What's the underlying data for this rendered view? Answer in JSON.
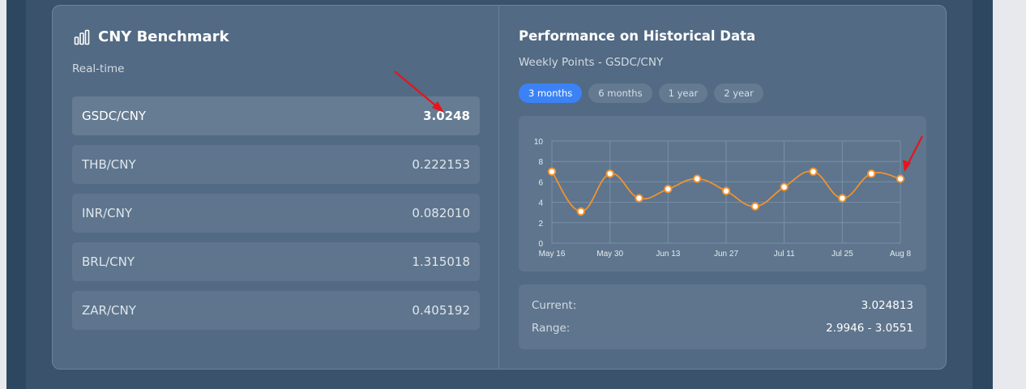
{
  "left_panel": {
    "title": "CNY Benchmark",
    "icon": "bar-chart-icon",
    "subtitle": "Real-time",
    "rates": [
      {
        "pair": "GSDC/CNY",
        "value": "3.0248",
        "active": true
      },
      {
        "pair": "THB/CNY",
        "value": "0.222153",
        "active": false
      },
      {
        "pair": "INR/CNY",
        "value": "0.082010",
        "active": false
      },
      {
        "pair": "BRL/CNY",
        "value": "1.315018",
        "active": false
      },
      {
        "pair": "ZAR/CNY",
        "value": "0.405192",
        "active": false
      }
    ]
  },
  "right_panel": {
    "title": "Performance on Historical Data",
    "subtitle": "Weekly Points - GSDC/CNY",
    "tabs": [
      {
        "label": "3 months",
        "active": true
      },
      {
        "label": "6 months",
        "active": false
      },
      {
        "label": "1 year",
        "active": false
      },
      {
        "label": "2 year",
        "active": false
      }
    ],
    "stats": {
      "current_label": "Current:",
      "current_value": "3.024813",
      "range_label": "Range:",
      "range_value": "2.9946 - 3.0551"
    }
  },
  "chart_data": {
    "type": "line",
    "x": [
      "May 16",
      "May 23",
      "May 30",
      "Jun 6",
      "Jun 13",
      "Jun 20",
      "Jun 27",
      "Jul 4",
      "Jul 11",
      "Jul 18",
      "Jul 25",
      "Aug 1",
      "Aug 8"
    ],
    "xticks": [
      "May 16",
      "May 30",
      "Jun 13",
      "Jun 27",
      "Jul 11",
      "Jul 25",
      "Aug 8"
    ],
    "values": [
      7.0,
      3.1,
      6.8,
      4.4,
      5.3,
      6.3,
      5.1,
      3.6,
      5.5,
      7.0,
      4.4,
      6.8,
      6.3
    ],
    "ylim": [
      0,
      10
    ],
    "yticks": [
      0,
      2,
      4,
      6,
      8,
      10
    ],
    "grid": true,
    "line_color": "#f0922e"
  },
  "colors": {
    "accent": "#3b82f6",
    "annotation_arrow": "#e8141a"
  }
}
